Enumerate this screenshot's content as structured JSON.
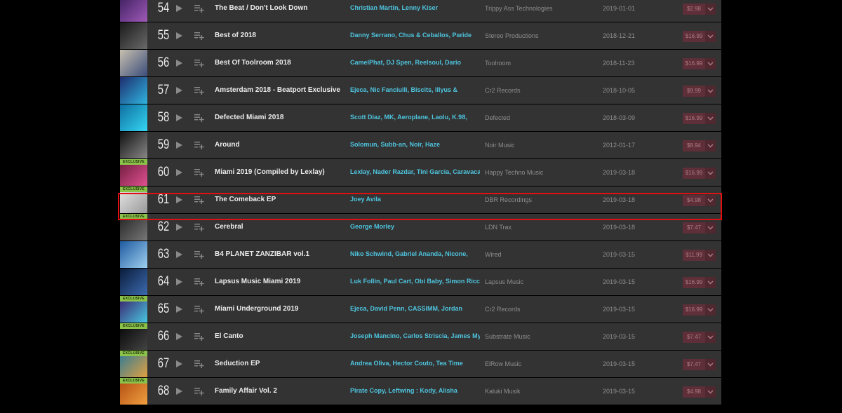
{
  "chart": {
    "rows": [
      {
        "rank": "54",
        "title": "The Beat / Don't Look Down",
        "artists": "Christian Martin, Lenny Kiser",
        "label": "Trippy Ass Technologies",
        "date": "2019-01-01",
        "price": "$2.98",
        "exclusive": false,
        "art": [
          "#3b1e5e",
          "#a05ab8"
        ]
      },
      {
        "rank": "55",
        "title": "Best of 2018",
        "artists": "Danny Serrano, Chus & Ceballos, Paride",
        "label": "Stereo Productions",
        "date": "2018-12-21",
        "price": "$16.99",
        "exclusive": false,
        "art": [
          "#1a1a1a",
          "#6a6a6a"
        ]
      },
      {
        "rank": "56",
        "title": "Best Of Toolroom 2018",
        "artists": "CamelPhat, DJ Spen, Reelsoul, Dario",
        "label": "Toolroom",
        "date": "2018-11-23",
        "price": "$16.99",
        "exclusive": false,
        "art": [
          "#c8c0b0",
          "#3a4c7a"
        ]
      },
      {
        "rank": "57",
        "title": "Amsterdam 2018 - Beatport Exclusive",
        "artists": "Ejeca, Nic Fanciulli, Biscits, Illyus &",
        "label": "Cr2 Records",
        "date": "2018-10-05",
        "price": "$9.99",
        "exclusive": false,
        "art": [
          "#1e2e6e",
          "#2fb5e0"
        ]
      },
      {
        "rank": "58",
        "title": "Defected Miami 2018",
        "artists": "Scott Diaz, MK, Aeroplane, Laolu, K.98,",
        "label": "Defected",
        "date": "2018-03-09",
        "price": "$16.99",
        "exclusive": false,
        "art": [
          "#0e6fa0",
          "#36d6f2"
        ]
      },
      {
        "rank": "59",
        "title": "Around",
        "artists": "Solomun, Subb-an, Noir, Haze",
        "label": "Noir Music",
        "date": "2012-01-17",
        "price": "$8.94",
        "exclusive": false,
        "art": [
          "#111111",
          "#888888"
        ]
      },
      {
        "rank": "60",
        "title": "Miami 2019 (Compiled by Lexlay)",
        "artists": "Lexlay, Nader Razdar, Tini Garcia, Caravaca,",
        "label": "Happy Techno Music",
        "date": "2019-03-18",
        "price": "$16.99",
        "exclusive": true,
        "art": [
          "#6a1a3a",
          "#e05090"
        ]
      },
      {
        "rank": "61",
        "title": "The Comeback EP",
        "artists": "Joey Avila",
        "label": "DBR Recordings",
        "date": "2019-03-18",
        "price": "$4.98",
        "exclusive": true,
        "art": [
          "#e8e8e8",
          "#999999"
        ]
      },
      {
        "rank": "62",
        "title": "Cerebral",
        "artists": "George Morley",
        "label": "LDN Trax",
        "date": "2019-03-18",
        "price": "$7.47",
        "exclusive": true,
        "art": [
          "#222222",
          "#777777"
        ]
      },
      {
        "rank": "63",
        "title": "B4 PLANET ZANZIBAR vol.1",
        "artists": "Niko Schwind, Gabriel Ananda, Nicone,",
        "label": "Wired",
        "date": "2019-03-15",
        "price": "$11.99",
        "exclusive": false,
        "art": [
          "#1e5aa0",
          "#9fd0f0"
        ]
      },
      {
        "rank": "64",
        "title": "Lapsus Music Miami 2019",
        "artists": "Luk Follin, Paul Cart, Obi Baby, Simon Ricci,",
        "label": "Lapsus Music",
        "date": "2019-03-15",
        "price": "$16.99",
        "exclusive": false,
        "art": [
          "#0a1c3a",
          "#3c6ab0"
        ]
      },
      {
        "rank": "65",
        "title": "Miami Underground 2019",
        "artists": "Ejeca, David Penn, CASSIMM, Jordan",
        "label": "Cr2 Records",
        "date": "2019-03-15",
        "price": "$16.99",
        "exclusive": true,
        "art": [
          "#3a1a6a",
          "#48c8e0"
        ]
      },
      {
        "rank": "66",
        "title": "El Canto",
        "artists": "Joseph Mancino, Carlos Striscia, James My",
        "label": "Substrate Music",
        "date": "2019-03-15",
        "price": "$7.47",
        "exclusive": true,
        "art": [
          "#050505",
          "#444444"
        ]
      },
      {
        "rank": "67",
        "title": "Seduction EP",
        "artists": "Andrea Oliva, Hector Couto, Tea Time",
        "label": "ElRow Music",
        "date": "2019-03-15",
        "price": "$7.47",
        "exclusive": true,
        "art": [
          "#2a7a9a",
          "#e0a040"
        ]
      },
      {
        "rank": "68",
        "title": "Family Affair Vol. 2",
        "artists": "Pirate Copy, Leftwing : Kody, Alisha",
        "label": "Kaluki Musik",
        "date": "2019-03-15",
        "price": "$4.98",
        "exclusive": true,
        "art": [
          "#b04a10",
          "#f0a040"
        ]
      }
    ]
  },
  "exclusive_badge": "EXCLUSIVE",
  "icons": {
    "play": "play-icon",
    "queue": "add-to-queue-icon",
    "dropdown": "chevron-down-icon"
  },
  "colors": {
    "artist_link": "#4ec4de",
    "price_button": "#5e2f38",
    "exclusive_badge": "#8bc24a",
    "row_background": "#333333",
    "highlight_box": "#e01010"
  },
  "highlighted_rank": "61"
}
